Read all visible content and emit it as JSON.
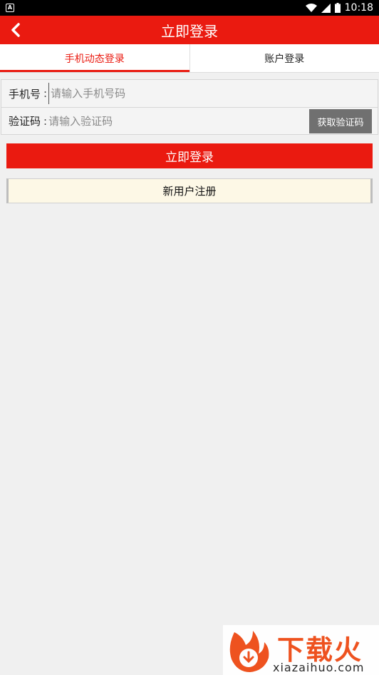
{
  "status_bar": {
    "time": "10:18",
    "notification_icon": "a-notification-icon",
    "icons": [
      "wifi-icon",
      "signal-icon",
      "battery-icon"
    ]
  },
  "header": {
    "title": "立即登录",
    "back_icon": "chevron-left-icon",
    "background": "#ea1a10"
  },
  "tabs": [
    {
      "label": "手机动态登录",
      "active": true
    },
    {
      "label": "账户登录",
      "active": false
    }
  ],
  "form": {
    "phone": {
      "label": "手机号",
      "colon": ":",
      "placeholder": "请输入手机号码",
      "value": ""
    },
    "code": {
      "label": "验证码",
      "colon": ":",
      "placeholder": "请输入验证码",
      "value": "",
      "button_label": "获取验证码"
    }
  },
  "buttons": {
    "login_label": "立即登录",
    "register_label": "新用户注册"
  },
  "watermark": {
    "brand": "下载火",
    "url": "xiazaihuo.com"
  },
  "colors": {
    "accent": "#ea1a10",
    "code_button": "#707070",
    "register_bg": "#fdf8e6"
  }
}
